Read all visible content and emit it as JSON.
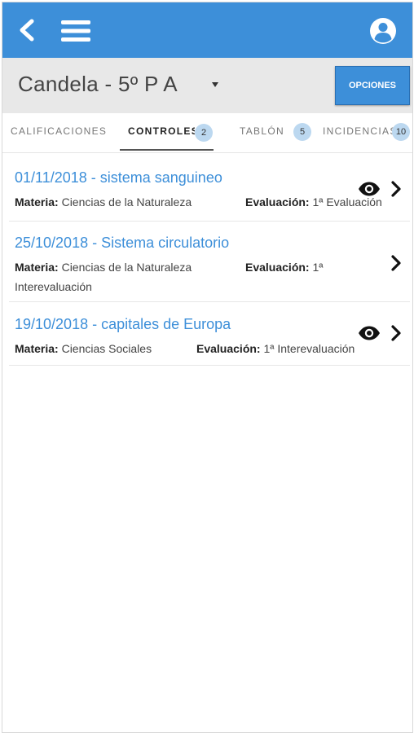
{
  "header": {
    "back_icon": "back-chevron-icon",
    "menu_icon": "hamburger-menu-icon",
    "user_icon": "user-account-icon",
    "color": "#3d8fd9"
  },
  "student": {
    "name": "Candela - 5º P A",
    "options_label": "OPCIONES"
  },
  "tabs": [
    {
      "label": "CALIFICACIONES",
      "badge": "",
      "active": false
    },
    {
      "label": "CONTROLES",
      "badge": "2",
      "active": true
    },
    {
      "label": "TABLÓN",
      "badge": "5",
      "active": false
    },
    {
      "label": "INCIDENCIAS",
      "badge": "10",
      "active": false
    }
  ],
  "controls": [
    {
      "title": "01/11/2018 - sistema sanguineo",
      "materia_label": "Materia:",
      "materia": "Ciencias de la Naturaleza",
      "evaluacion_label": "Evaluación:",
      "evaluacion": "1ª Evaluación",
      "seen": true
    },
    {
      "title": "25/10/2018 - Sistema circulatorio",
      "materia_label": "Materia:",
      "materia": "Ciencias de la Naturaleza",
      "evaluacion_label": "Evaluación:",
      "evaluacion": "1ª",
      "evaluacion_cont": "Interevaluación",
      "seen": false
    },
    {
      "title": "19/10/2018 - capitales de Europa",
      "materia_label": "Materia:",
      "materia": "Ciencias Sociales",
      "evaluacion_label": "Evaluación:",
      "evaluacion": "1ª Interevaluación",
      "seen": true
    }
  ]
}
